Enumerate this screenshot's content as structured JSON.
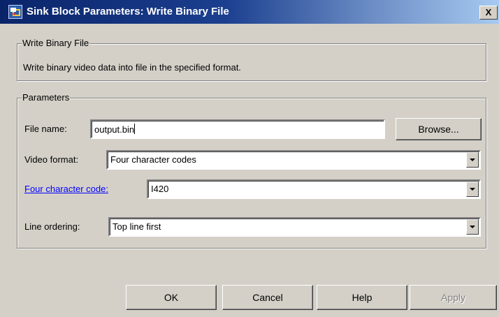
{
  "window": {
    "title": "Sink Block Parameters: Write Binary File",
    "close_label": "X"
  },
  "block_group": {
    "legend": "Write Binary File",
    "description": "Write binary video data into file in the specified format."
  },
  "parameters": {
    "legend": "Parameters",
    "file_name": {
      "label": "File name:",
      "value": "output.bin",
      "browse_label": "Browse..."
    },
    "video_format": {
      "label": "Video format:",
      "value": "Four character codes"
    },
    "four_cc": {
      "label": "Four character code:",
      "value": "I420"
    },
    "line_ordering": {
      "label": "Line ordering:",
      "value": "Top line first"
    }
  },
  "buttons": {
    "ok": "OK",
    "cancel": "Cancel",
    "help": "Help",
    "apply": "Apply"
  },
  "icons": [
    "block-icon",
    "chevron-down-icon"
  ]
}
